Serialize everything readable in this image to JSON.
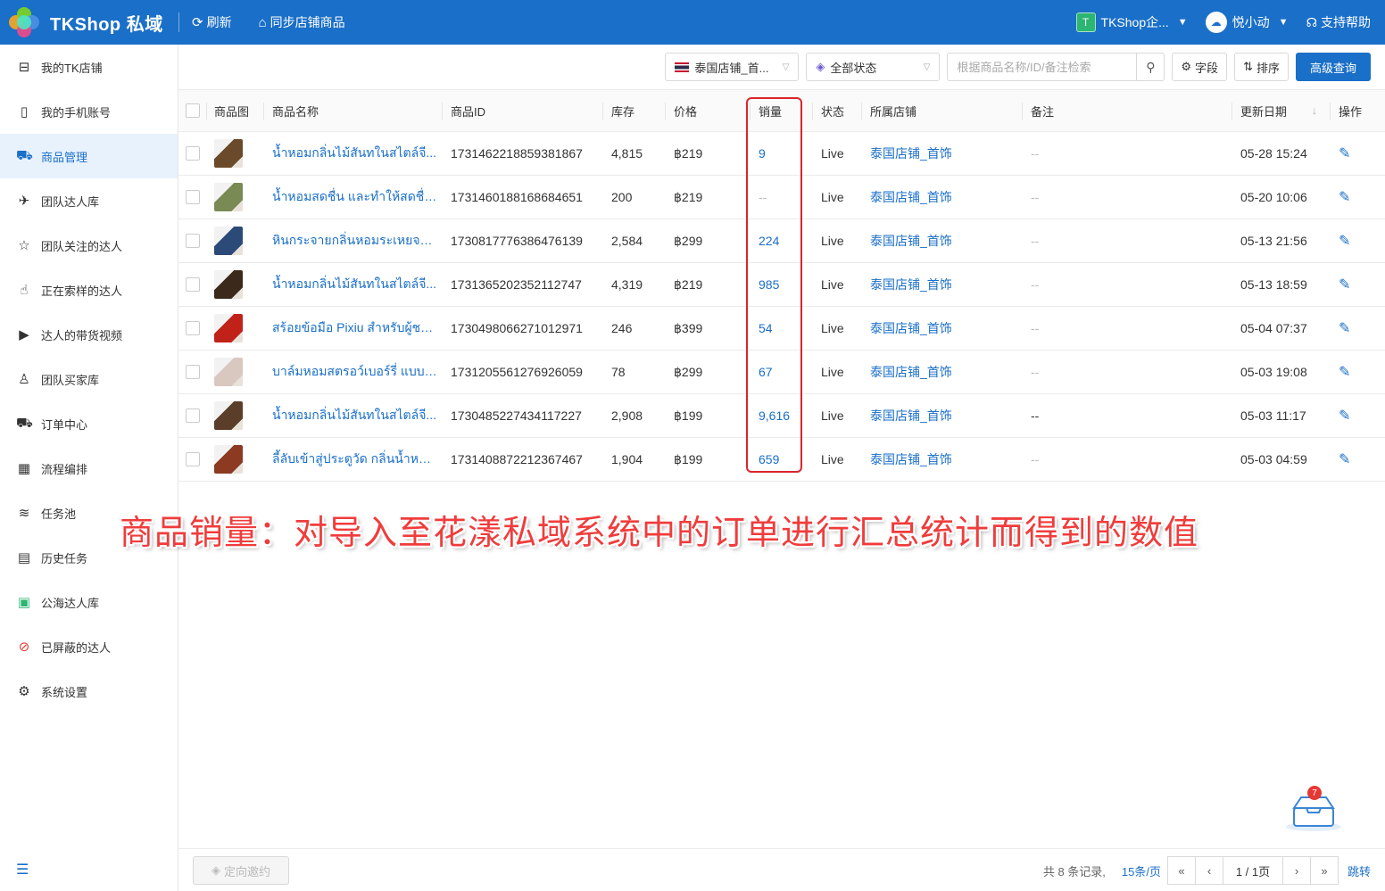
{
  "app": {
    "title": "TKShop 私域"
  },
  "topbar": {
    "refresh_label": "刷新",
    "sync_label": "同步店铺商品",
    "workspace_label": "TKShop企...",
    "workspace_initial": "T",
    "user_label": "悦小动",
    "help_label": "支持帮助"
  },
  "sidebar": {
    "items": [
      {
        "label": "我的TK店铺",
        "icon": "store-icon"
      },
      {
        "label": "我的手机账号",
        "icon": "phone-icon"
      },
      {
        "label": "商品管理",
        "icon": "cart-icon",
        "active": true
      },
      {
        "label": "团队达人库",
        "icon": "people-icon"
      },
      {
        "label": "团队关注的达人",
        "icon": "star-icon"
      },
      {
        "label": "正在索样的达人",
        "icon": "hand-icon"
      },
      {
        "label": "达人的带货视频",
        "icon": "video-icon"
      },
      {
        "label": "团队买家库",
        "icon": "user-icon"
      },
      {
        "label": "订单中心",
        "icon": "truck-icon"
      },
      {
        "label": "流程编排",
        "icon": "calendar-icon"
      },
      {
        "label": "任务池",
        "icon": "layers-icon"
      },
      {
        "label": "历史任务",
        "icon": "clipboard-icon"
      },
      {
        "label": "公海达人库",
        "icon": "public-icon"
      },
      {
        "label": "已屏蔽的达人",
        "icon": "block-icon"
      },
      {
        "label": "系统设置",
        "icon": "gear-icon"
      }
    ]
  },
  "toolbar": {
    "shop_select": "泰国店铺_首...",
    "status_select": "全部状态",
    "search_placeholder": "根据商品名称/ID/备注检索",
    "fields_label": "字段",
    "sort_label": "排序",
    "advanced_label": "高级查询"
  },
  "table": {
    "columns": [
      "商品图",
      "商品名称",
      "商品ID",
      "库存",
      "价格",
      "销量",
      "状态",
      "所属店铺",
      "备注",
      "更新日期",
      "操作"
    ],
    "rows": [
      {
        "name": "น้ำหอมกลิ่นไม้สันทในสไตล์จี...",
        "id": "1731462218859381867",
        "stock": "4,815",
        "price": "฿219",
        "sales": "9",
        "status": "Live",
        "shop": "泰国店铺_首饰",
        "note": "--",
        "updated": "05-28 15:24",
        "thumb": "#6b4a2b"
      },
      {
        "name": "น้ำหอมสดชื่น และทำให้สดชื่น...",
        "id": "1731460188168684651",
        "stock": "200",
        "price": "฿219",
        "sales": "--",
        "status": "Live",
        "shop": "泰国店铺_首饰",
        "note": "--",
        "updated": "05-20 10:06",
        "thumb": "#7a8a55"
      },
      {
        "name": "หินกระจายกลิ่นหอมระเหยจาก...",
        "id": "1730817776386476139",
        "stock": "2,584",
        "price": "฿299",
        "sales": "224",
        "status": "Live",
        "shop": "泰国店铺_首饰",
        "note": "--",
        "updated": "05-13 21:56",
        "thumb": "#2c4a78"
      },
      {
        "name": "น้ำหอมกลิ่นไม้สันทในสไตล์จี...",
        "id": "1731365202352112747",
        "stock": "4,319",
        "price": "฿219",
        "sales": "985",
        "status": "Live",
        "shop": "泰国店铺_首饰",
        "note": "--",
        "updated": "05-13 18:59",
        "thumb": "#3b2a1c"
      },
      {
        "name": "สร้อยข้อมือ Pixiu สำหรับผู้ชา...",
        "id": "1730498066271012971",
        "stock": "246",
        "price": "฿399",
        "sales": "54",
        "status": "Live",
        "shop": "泰国店铺_首饰",
        "note": "--",
        "updated": "05-04 07:37",
        "thumb": "#c0221a"
      },
      {
        "name": "บาล์มหอมสตรอว์เบอร์รี่ แบบแ...",
        "id": "1731205561276926059",
        "stock": "78",
        "price": "฿299",
        "sales": "67",
        "status": "Live",
        "shop": "泰国店铺_首饰",
        "note": "--",
        "updated": "05-03 19:08",
        "thumb": "#d9c8c0"
      },
      {
        "name": "น้ำหอมกลิ่นไม้สันทในสไตล์จี...",
        "id": "1730485227434117227",
        "stock": "2,908",
        "price": "฿199",
        "sales": "9,616",
        "status": "Live",
        "shop": "泰国店铺_首饰",
        "note": "--",
        "updated": "05-03 11:17",
        "thumb": "#5a3e2a"
      },
      {
        "name": "ลี้ลับเข้าสู่ประตูวัด กลิ่นน้ำหอม...",
        "id": "1731408872212367467",
        "stock": "1,904",
        "price": "฿199",
        "sales": "659",
        "status": "Live",
        "shop": "泰国店铺_首饰",
        "note": "--",
        "updated": "05-03 04:59",
        "thumb": "#8c3a22"
      }
    ]
  },
  "annotation": {
    "caption": "商品销量：对导入至花漾私域系统中的订单进行汇总统计而得到的数值"
  },
  "bottom": {
    "invite_label": "定向邀约",
    "total_text": "共 8 条记录,",
    "page_size": "15条/页",
    "page_indicator": "1 / 1页",
    "jump_label": "跳转"
  },
  "mailbox": {
    "badge": "7"
  },
  "colors": {
    "primary": "#1a6fc8",
    "highlight": "#d9252c",
    "caption": "#f03c3c"
  }
}
